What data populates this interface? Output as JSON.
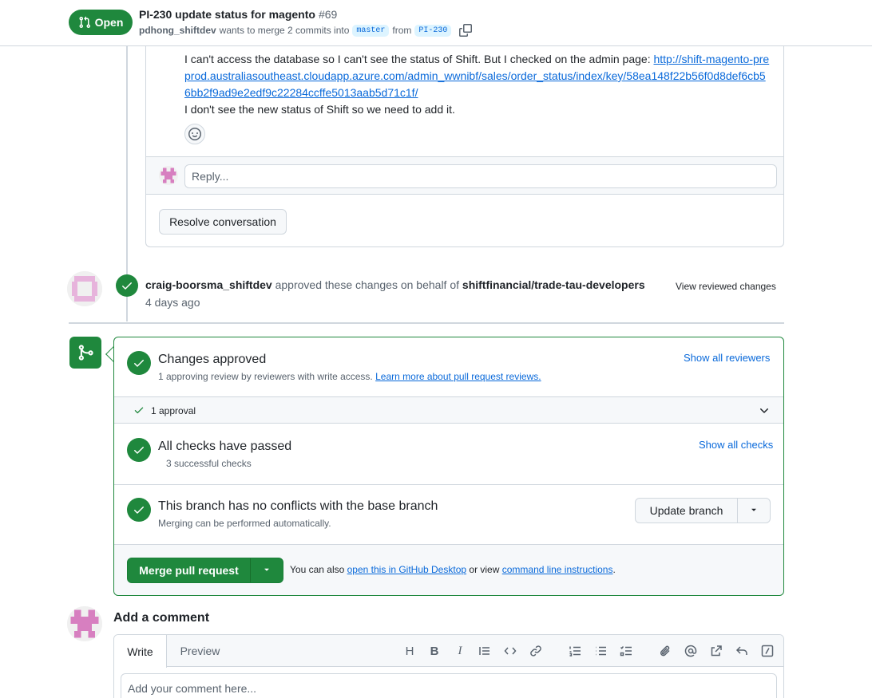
{
  "header": {
    "state": "Open",
    "title": "PI-230 update status for magento",
    "number": "#69",
    "author": "pdhong_shiftdev",
    "merge_text": "wants to merge 2 commits into",
    "base_branch": "master",
    "from_text": "from",
    "head_branch": "PI-230"
  },
  "review_comment": {
    "line1": "I can't access the database so I can't see the status of Shift. But I checked on the admin page:",
    "link": "http://shift-magento-preprod.australiasoutheast.cloudapp.azure.com/admin_wwnibf/sales/order_status/index/key/58ea148f22b56f0d8def6cb56bb2f9ad9e2edf9c22284ccffe5013aab5d71c1f/",
    "line2": "I don't see the new status of Shift so we need to add it.",
    "reply_placeholder": "Reply...",
    "resolve_label": "Resolve conversation"
  },
  "approval_event": {
    "user": "craig-boorsma_shiftdev",
    "action": "approved these changes on behalf of",
    "team": "shiftfinancial/trade-tau-developers",
    "time": "4 days ago",
    "view_label": "View reviewed changes"
  },
  "merge_box": {
    "approved_title": "Changes approved",
    "approved_sub": "1 approving review by reviewers with write access.",
    "approved_link": "Learn more about pull request reviews.",
    "show_reviewers": "Show all reviewers",
    "approvals_label": "1 approval",
    "checks_title": "All checks have passed",
    "checks_sub": "3 successful checks",
    "show_checks": "Show all checks",
    "conflicts_title": "This branch has no conflicts with the base branch",
    "conflicts_sub": "Merging can be performed automatically.",
    "update_branch_label": "Update branch",
    "merge_label": "Merge pull request",
    "help_prefix": "You can also",
    "help_link1": "open this in GitHub Desktop",
    "help_mid": "or view",
    "help_link2": "command line instructions",
    "help_suffix": "."
  },
  "add_comment": {
    "title": "Add a comment",
    "tab_write": "Write",
    "tab_preview": "Preview",
    "placeholder": "Add your comment here...",
    "toolbar": [
      "heading-icon",
      "bold-icon",
      "italic-icon",
      "quote-icon",
      "code-icon",
      "link-icon",
      "ordered-list-icon",
      "unordered-list-icon",
      "task-list-icon",
      "attach-icon",
      "mention-icon",
      "reference-icon",
      "reply-icon",
      "slash-command-icon"
    ]
  },
  "colors": {
    "success": "#1f883d",
    "link": "#0969da",
    "border": "#d0d7de",
    "muted": "#59636e"
  }
}
